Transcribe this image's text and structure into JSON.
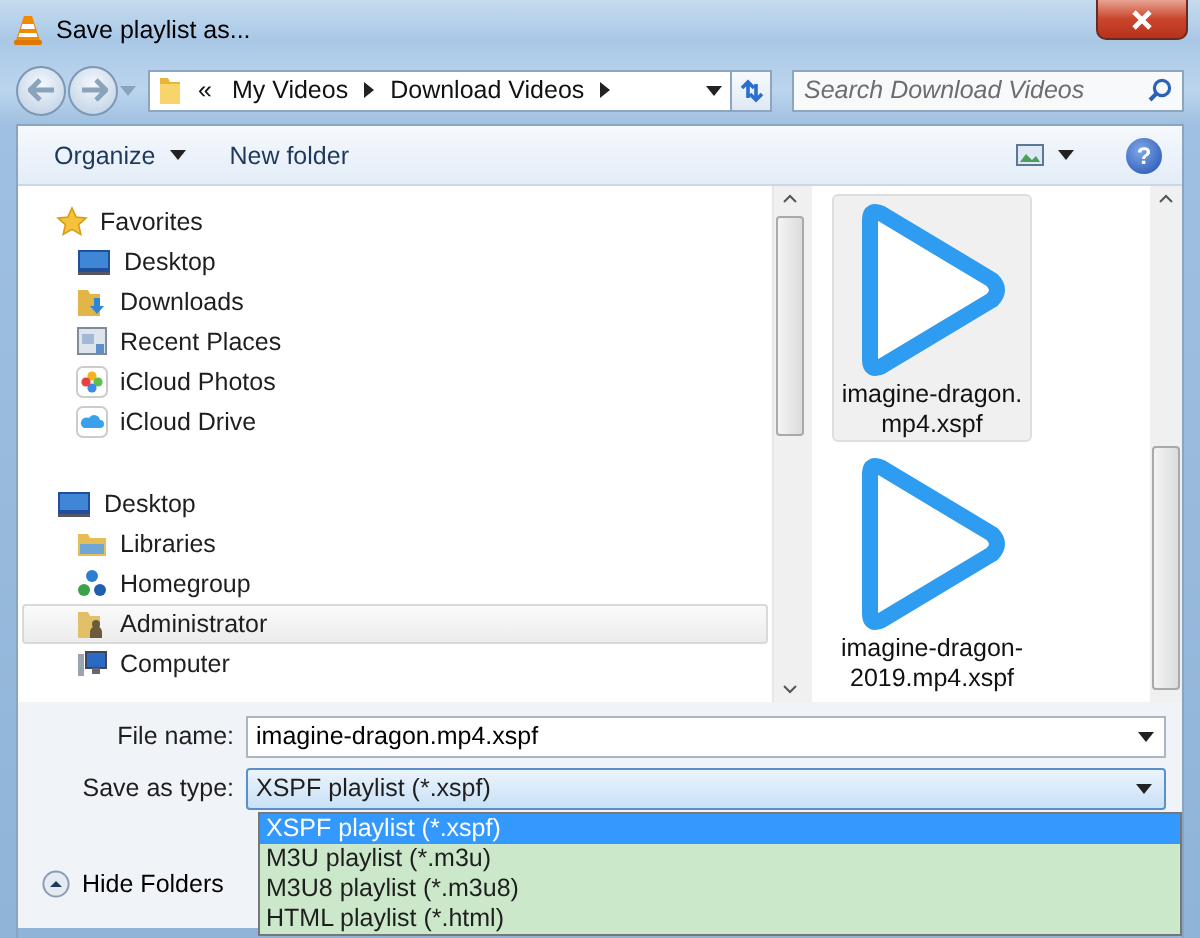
{
  "window": {
    "title": "Save playlist as..."
  },
  "address_bar": {
    "overflow": "«",
    "path": [
      "My Videos",
      "Download Videos"
    ]
  },
  "search": {
    "placeholder": "Search Download Videos"
  },
  "toolbar": {
    "organize": "Organize",
    "new_folder": "New folder",
    "help": "?"
  },
  "navigation": [
    {
      "label": "Favorites",
      "kind": "star",
      "selected": false,
      "children": [
        {
          "label": "Desktop",
          "kind": "desktop",
          "selected": false
        },
        {
          "label": "Downloads",
          "kind": "downloads",
          "selected": false
        },
        {
          "label": "Recent Places",
          "kind": "recent",
          "selected": false
        },
        {
          "label": "iCloud Photos",
          "kind": "photos",
          "selected": false
        },
        {
          "label": "iCloud Drive",
          "kind": "cloud",
          "selected": false
        }
      ]
    },
    {
      "label": "Desktop",
      "kind": "desktop",
      "selected": false,
      "children": [
        {
          "label": "Libraries",
          "kind": "libraries",
          "selected": false
        },
        {
          "label": "Homegroup",
          "kind": "homegroup",
          "selected": false
        },
        {
          "label": "Administrator",
          "kind": "user",
          "selected": true
        },
        {
          "label": "Computer",
          "kind": "computer",
          "selected": false
        }
      ]
    }
  ],
  "files": [
    {
      "name": "imagine-dragon.\nmp4.xspf",
      "selected": true
    },
    {
      "name": "imagine-dragon-\n2019.mp4.xspf",
      "selected": false
    }
  ],
  "footer": {
    "file_name": {
      "label": "File name:",
      "value": "imagine-dragon.mp4.xspf"
    },
    "save_type": {
      "label": "Save as type:",
      "value": "XSPF playlist (*.xspf)",
      "expanded": true,
      "options": [
        {
          "label": "XSPF playlist (*.xspf)",
          "selected": true
        },
        {
          "label": "M3U playlist (*.m3u)",
          "selected": false
        },
        {
          "label": "M3U8 playlist (*.m3u8)",
          "selected": false
        },
        {
          "label": "HTML playlist (*.html)",
          "selected": false
        }
      ]
    },
    "hide_folders": "Hide Folders"
  }
}
